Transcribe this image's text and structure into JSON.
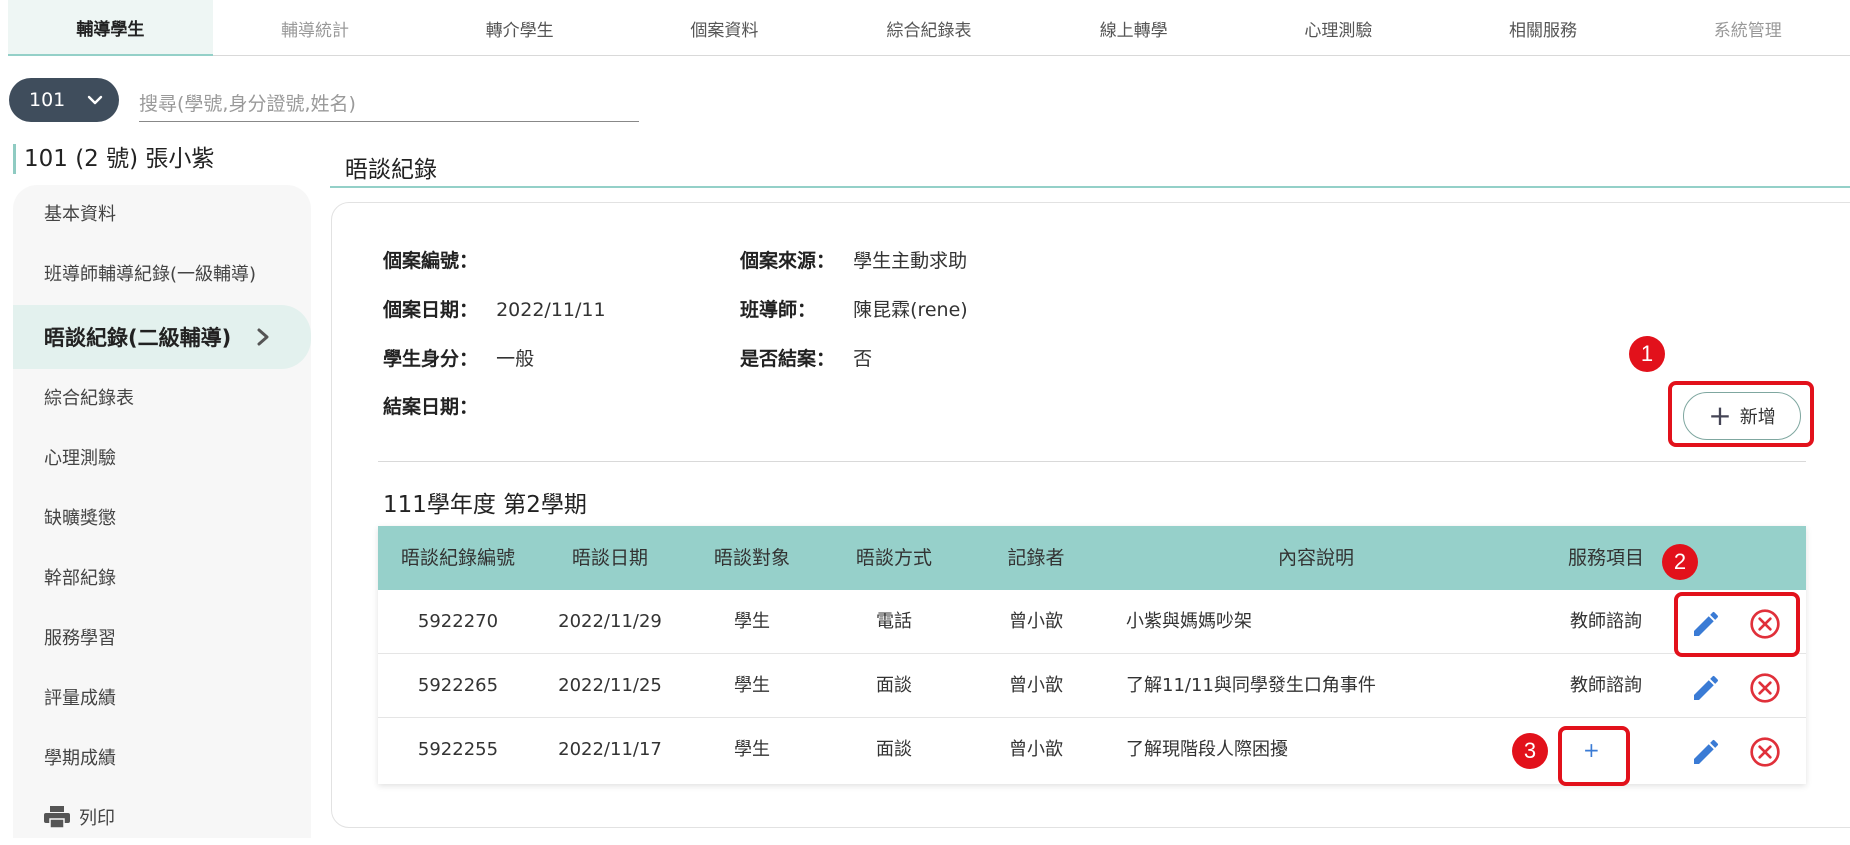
{
  "tabs": [
    "輔導學生",
    "輔導統計",
    "轉介學生",
    "個案資料",
    "綜合紀錄表",
    "線上轉學",
    "心理測驗",
    "相關服務",
    "系統管理"
  ],
  "class_select": "101",
  "search_placeholder": "搜尋(學號,身分證號,姓名)",
  "student_heading": "101 (2 號)  張小紫",
  "sidebar": {
    "items": [
      "基本資料",
      "班導師輔導紀錄(一級輔導)",
      "晤談紀錄(二級輔導)",
      "綜合紀錄表",
      "心理測驗",
      "缺曠獎懲",
      "幹部紀錄",
      "服務學習",
      "評量成績",
      "學期成績"
    ],
    "print_label": "列印"
  },
  "section_title": "晤談紀錄",
  "case_info": {
    "case_no_label": "個案編號：",
    "case_no": "",
    "source_label": "個案來源：",
    "source": "學生主動求助",
    "date_label": "個案日期：",
    "date": "2022/11/11",
    "teacher_label": "班導師：",
    "teacher": "陳昆霖(rene)",
    "identity_label": "學生身分：",
    "identity": "一般",
    "closed_label": "是否結案：",
    "closed": "否",
    "close_date_label": "結案日期：",
    "close_date": ""
  },
  "add_button": "新增",
  "term_heading": "111學年度 第2學期",
  "table": {
    "headers": [
      "晤談紀錄編號",
      "晤談日期",
      "晤談對象",
      "晤談方式",
      "記錄者",
      "內容說明",
      "服務項目"
    ],
    "rows": [
      {
        "id": "5922270",
        "date": "2022/11/29",
        "target": "學生",
        "method": "電話",
        "recorder": "曾小歆",
        "content": "小紫與媽媽吵架",
        "service": "教師諮詢"
      },
      {
        "id": "5922265",
        "date": "2022/11/25",
        "target": "學生",
        "method": "面談",
        "recorder": "曾小歆",
        "content": "了解11/11與同學發生口角事件",
        "service": "教師諮詢"
      },
      {
        "id": "5922255",
        "date": "2022/11/17",
        "target": "學生",
        "method": "面談",
        "recorder": "曾小歆",
        "content": "了解現階段人際困擾",
        "service": "+"
      }
    ]
  },
  "annotations": [
    "1",
    "2",
    "3"
  ],
  "colors": {
    "accent": "#94d0c8",
    "header_bg": "#96d0ca",
    "edit": "#3a7bd5",
    "delete": "#e0303a",
    "annotation": "#e2111b"
  }
}
